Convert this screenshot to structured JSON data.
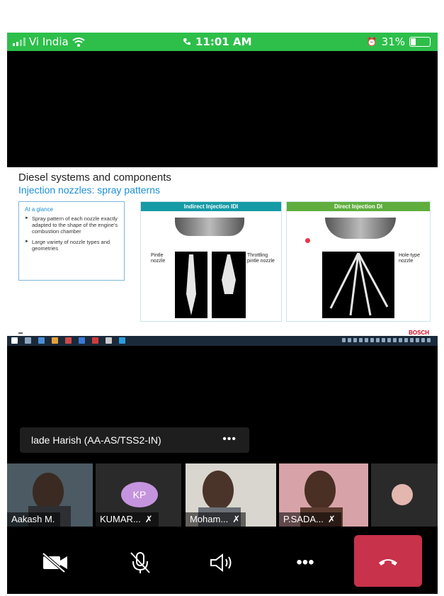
{
  "status_bar": {
    "carrier": "Vi India",
    "time": "11:01 AM",
    "battery": "31%",
    "battery_level": 0.31
  },
  "slide": {
    "title": "Diesel systems and components",
    "subtitle": "Injection nozzles: spray patterns",
    "glance": {
      "heading": "At a glance",
      "bullets": [
        "Spray pattern of each nozzle exactly adapted to the shape of the engine's combustion chamber",
        "Large variety of nozzle types and geometries"
      ]
    },
    "panels": [
      {
        "header": "Indirect Injection IDI",
        "color": "#159aa6",
        "labels": [
          "Pintle nozzle",
          "Throttling pintle nozzle"
        ]
      },
      {
        "header": "Direct Injection DI",
        "color": "#5fae3d",
        "labels": [
          "Hole-type nozzle"
        ]
      }
    ],
    "brand": "BOSCH"
  },
  "speaker": {
    "name": "lade Harish (AA-AS/TSS2-IN)",
    "more": "•••"
  },
  "participants": [
    {
      "name": "Aakash M.",
      "muted": false
    },
    {
      "name": "KUMAR...",
      "muted": true,
      "initials": "KP"
    },
    {
      "name": "Moham...",
      "muted": true
    },
    {
      "name": "P.SADA...",
      "muted": true
    }
  ],
  "controls": {
    "more": "•••"
  }
}
